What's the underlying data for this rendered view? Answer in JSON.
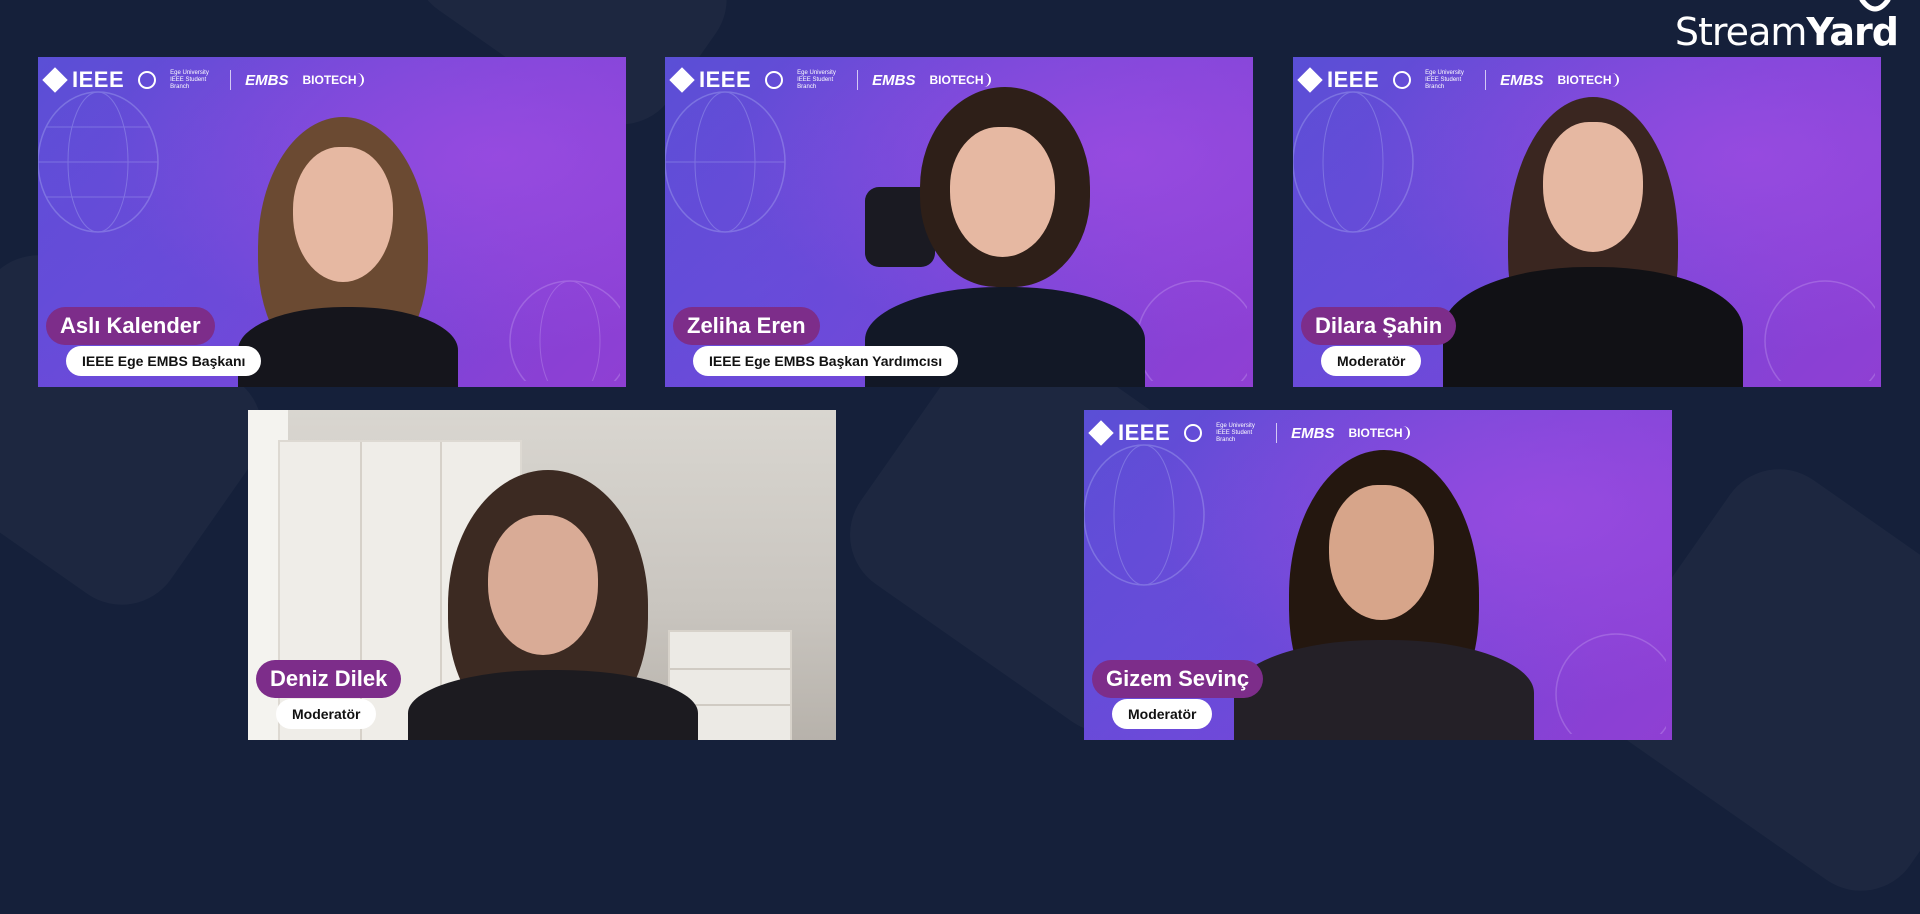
{
  "brand": {
    "name_light": "Stream",
    "name_bold": "Yard"
  },
  "overlay_logos": {
    "ieee": "IEEE",
    "university": "Ege University IEEE Student Branch",
    "embs": "EMBS",
    "biotech": "BIOTECH"
  },
  "participants": [
    {
      "name": "Aslı Kalender",
      "role": "IEEE Ege EMBS Başkanı",
      "background": "branded",
      "hair": "#6b4a32"
    },
    {
      "name": "Zeliha Eren",
      "role": "IEEE Ege EMBS Başkan Yardımcısı",
      "background": "branded",
      "hair": "#2e1f18"
    },
    {
      "name": "Dilara Şahin",
      "role": "Moderatör",
      "background": "branded",
      "hair": "#3a2620"
    },
    {
      "name": "Deniz Dilek",
      "role": "Moderatör",
      "background": "room",
      "hair": "#3c2a22"
    },
    {
      "name": "Gizem Sevinç",
      "role": "Moderatör",
      "background": "branded",
      "hair": "#24170f"
    }
  ],
  "colors": {
    "background": "#15203a",
    "name_pill": "#7d2d8a",
    "role_pill": "#ffffff",
    "tile_purple": "#7b45d8"
  }
}
